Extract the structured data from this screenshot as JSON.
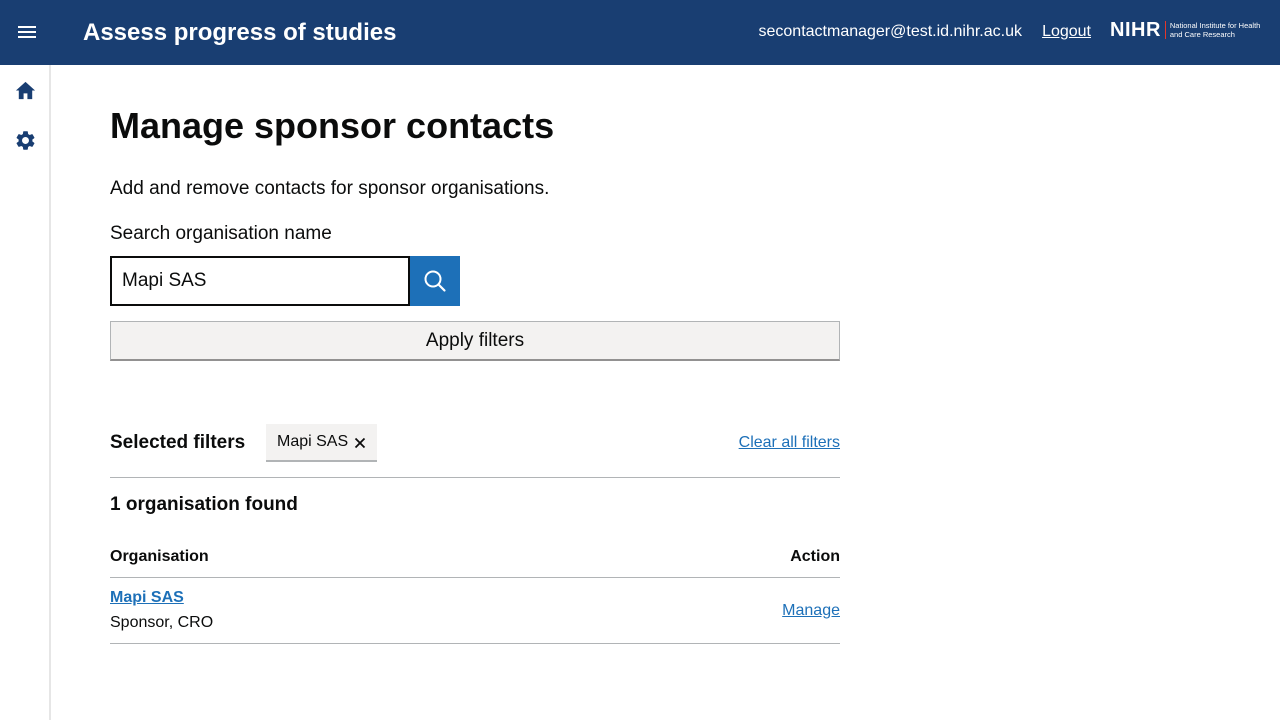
{
  "header": {
    "app_title": "Assess progress of studies",
    "user_email": "secontactmanager@test.id.nihr.ac.uk",
    "logout_label": "Logout",
    "logo_text": "NIHR",
    "logo_subtext": "National Institute for Health and Care Research",
    "background_color": "#193e72"
  },
  "sidebar": {
    "items": [
      {
        "icon": "home-icon"
      },
      {
        "icon": "gear-icon"
      }
    ]
  },
  "main": {
    "title": "Manage sponsor contacts",
    "intro": "Add and remove contacts for sponsor organisations.",
    "search": {
      "label": "Search organisation name",
      "value": "Mapi SAS",
      "button_icon": "search-icon"
    },
    "apply_filters_label": "Apply filters",
    "filters": {
      "heading": "Selected filters",
      "tags": [
        {
          "label": "Mapi SAS"
        }
      ],
      "clear_all_label": "Clear all filters"
    },
    "results_count": "1 organisation found",
    "table": {
      "headers": {
        "organisation": "Organisation",
        "action": "Action"
      },
      "rows": [
        {
          "organisation": "Mapi SAS",
          "type": "Sponsor, CRO",
          "action": "Manage"
        }
      ]
    },
    "link_color": "#1d70b8"
  }
}
